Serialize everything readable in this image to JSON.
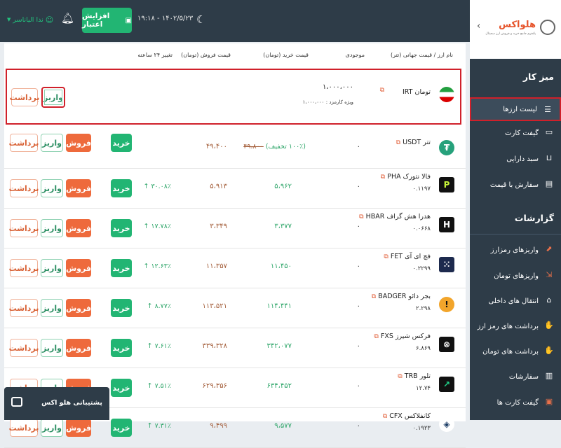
{
  "header": {
    "user_name": "ندا الیاناسر",
    "credit_button": "افزایش اعتبار",
    "datetime": "۱۹:۱۸ - ۱۴۰۲/۵/۲۳"
  },
  "brand": {
    "name": "هلواکس",
    "tagline": "پلتفرم جامع خرید و فروش ارز دیجیتال"
  },
  "sidebar": {
    "section1": "میز کار",
    "items1": [
      {
        "label": "لیست ارزها"
      },
      {
        "label": "گیفت کارت"
      },
      {
        "label": "سبد دارایی"
      },
      {
        "label": "سفارش با قیمت"
      }
    ],
    "section2": "گزارشات",
    "items2": [
      {
        "label": "واریزهای رمزارز"
      },
      {
        "label": "واریزهای تومان"
      },
      {
        "label": "انتقال های داخلی"
      },
      {
        "label": "برداشت های رمز ارز"
      },
      {
        "label": "برداشت های تومان"
      },
      {
        "label": "سفارشات"
      },
      {
        "label": "گیفت کارت ها"
      }
    ]
  },
  "table": {
    "headers": {
      "name": "نام ارز / قیمت جهانی (تتر)",
      "balance": "موجودی",
      "buy": "قیمت خرید (تومان)",
      "sell": "قیمت فروش (تومان)",
      "change": "تغییر ۲۴ ساعته"
    },
    "buttons": {
      "buy": "خرید",
      "sell": "فروش",
      "deposit": "واریز",
      "withdraw": "برداشت"
    },
    "toman": {
      "name": "تومان IRT",
      "balance": "۱،۰۰۰،۰۰۰",
      "special_label": "ویژه کارمزد :",
      "special_value": "۱،۰۰۰،۰۰۰"
    },
    "rows": [
      {
        "name": "تتر USDT",
        "price": "",
        "balance": "۰",
        "buy": "(۱۰۰٪ تخفیف)",
        "buy_old": "۴۹،۸۰۰",
        "sell": "۴۹،۴۰۰",
        "change": ""
      },
      {
        "name": "فالا نتورک PHA",
        "price": "۰.۱۱۹۷",
        "balance": "۰",
        "buy": "۵،۹۶۲",
        "sell": "۵،۹۱۳",
        "change": "۳۰.۰۸٪ ↑"
      },
      {
        "name": "هدرا هش گراف HBAR",
        "price": "۰.۰۶۶۸",
        "balance": "۰",
        "buy": "۳،۳۷۷",
        "sell": "۳،۳۴۹",
        "change": "۱۷.۷۸٪ ↑"
      },
      {
        "name": "فچ ای آی FET",
        "price": "۰.۲۲۹۹",
        "balance": "۰",
        "buy": "۱۱،۴۵۰",
        "sell": "۱۱،۳۵۷",
        "change": "۱۲.۶۳٪ ↑"
      },
      {
        "name": "بجر دائو BADGER",
        "price": "۲.۲۹۸",
        "balance": "۰",
        "buy": "۱۱۴،۴۴۱",
        "sell": "۱۱۳،۵۲۱",
        "change": "۸.۷۷٪ ↑"
      },
      {
        "name": "فرکس شیرز FXS",
        "price": "۶.۸۶۹",
        "balance": "۰",
        "buy": "۳۴۲،۰۷۷",
        "sell": "۳۳۹،۳۲۸",
        "change": "۷.۶۱٪ ↑"
      },
      {
        "name": "تلور TRB",
        "price": "۱۲.۷۴",
        "balance": "۰",
        "buy": "۶۳۴،۴۵۲",
        "sell": "۶۲۹،۳۵۶",
        "change": "۷.۵۱٪ ↑"
      },
      {
        "name": "کانفلاکس CFX",
        "price": "۰.۱۹۲۳",
        "balance": "۰",
        "buy": "۹،۵۷۷",
        "sell": "۹،۴۹۹",
        "change": "۷.۳۱٪ ↑"
      }
    ]
  },
  "support": {
    "label": "پشتیبانی هلو اکس"
  }
}
